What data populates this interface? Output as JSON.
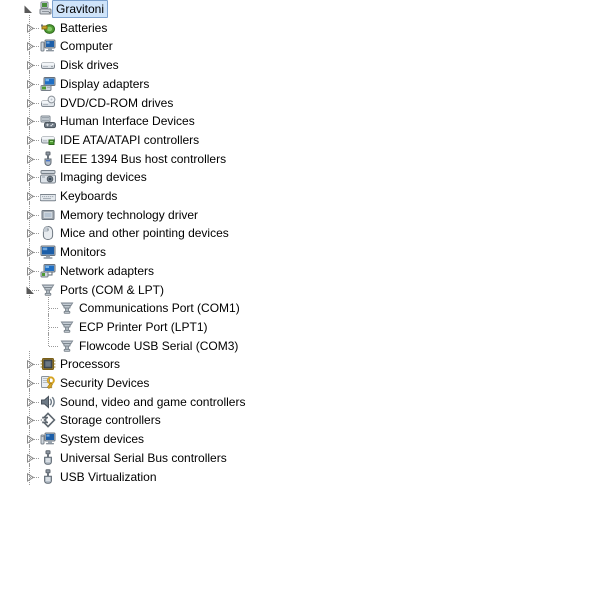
{
  "window": {
    "title": "Device Manager",
    "background_color": "#ffffff",
    "text_color": "#000000",
    "selection_fill": "#cfe4fa",
    "selection_border": "#7da2ce",
    "tree_line_color": "#9a9a9a"
  },
  "tree": {
    "root": {
      "label": "Gravitoni",
      "icon": "computer-icon",
      "level": 0,
      "expanded": true,
      "selected": true
    },
    "nodes": [
      {
        "label": "Batteries",
        "icon": "battery-icon",
        "level": 1,
        "expanded": false,
        "selected": false
      },
      {
        "label": "Computer",
        "icon": "computer-monitor-icon",
        "level": 1,
        "expanded": false,
        "selected": false
      },
      {
        "label": "Disk drives",
        "icon": "disk-drive-icon",
        "level": 1,
        "expanded": false,
        "selected": false
      },
      {
        "label": "Display adapters",
        "icon": "display-adapter-icon",
        "level": 1,
        "expanded": false,
        "selected": false
      },
      {
        "label": "DVD/CD-ROM drives",
        "icon": "dvd-cdrom-icon",
        "level": 1,
        "expanded": false,
        "selected": false
      },
      {
        "label": "Human Interface Devices",
        "icon": "hid-gamepad-icon",
        "level": 1,
        "expanded": false,
        "selected": false
      },
      {
        "label": "IDE ATA/ATAPI controllers",
        "icon": "ide-controller-icon",
        "level": 1,
        "expanded": false,
        "selected": false
      },
      {
        "label": "IEEE 1394 Bus host controllers",
        "icon": "firewire-icon",
        "level": 1,
        "expanded": false,
        "selected": false
      },
      {
        "label": "Imaging devices",
        "icon": "camera-icon",
        "level": 1,
        "expanded": false,
        "selected": false
      },
      {
        "label": "Keyboards",
        "icon": "keyboard-icon",
        "level": 1,
        "expanded": false,
        "selected": false
      },
      {
        "label": "Memory technology driver",
        "icon": "memory-card-icon",
        "level": 1,
        "expanded": false,
        "selected": false
      },
      {
        "label": "Mice and other pointing devices",
        "icon": "mouse-icon",
        "level": 1,
        "expanded": false,
        "selected": false
      },
      {
        "label": "Monitors",
        "icon": "monitor-icon",
        "level": 1,
        "expanded": false,
        "selected": false
      },
      {
        "label": "Network adapters",
        "icon": "network-adapter-icon",
        "level": 1,
        "expanded": false,
        "selected": false
      },
      {
        "label": "Ports (COM & LPT)",
        "icon": "serial-port-icon",
        "level": 1,
        "expanded": true,
        "selected": false
      },
      {
        "label": "Communications Port (COM1)",
        "icon": "serial-port-icon",
        "level": 2,
        "expanded": null,
        "selected": false
      },
      {
        "label": "ECP Printer Port (LPT1)",
        "icon": "serial-port-icon",
        "level": 2,
        "expanded": null,
        "selected": false
      },
      {
        "label": "Flowcode USB Serial (COM3)",
        "icon": "serial-port-icon",
        "level": 2,
        "expanded": null,
        "selected": false,
        "last_child": true
      },
      {
        "label": "Processors",
        "icon": "processor-icon",
        "level": 1,
        "expanded": false,
        "selected": false
      },
      {
        "label": "Security Devices",
        "icon": "security-key-icon",
        "level": 1,
        "expanded": false,
        "selected": false
      },
      {
        "label": "Sound, video and game controllers",
        "icon": "speaker-icon",
        "level": 1,
        "expanded": false,
        "selected": false
      },
      {
        "label": "Storage controllers",
        "icon": "storage-controller-icon",
        "level": 1,
        "expanded": false,
        "selected": false
      },
      {
        "label": "System devices",
        "icon": "system-device-icon",
        "level": 1,
        "expanded": false,
        "selected": false
      },
      {
        "label": "Universal Serial Bus controllers",
        "icon": "usb-icon",
        "level": 1,
        "expanded": false,
        "selected": false
      },
      {
        "label": "USB Virtualization",
        "icon": "usb-icon",
        "level": 1,
        "expanded": false,
        "selected": false,
        "last_child": true
      }
    ]
  }
}
